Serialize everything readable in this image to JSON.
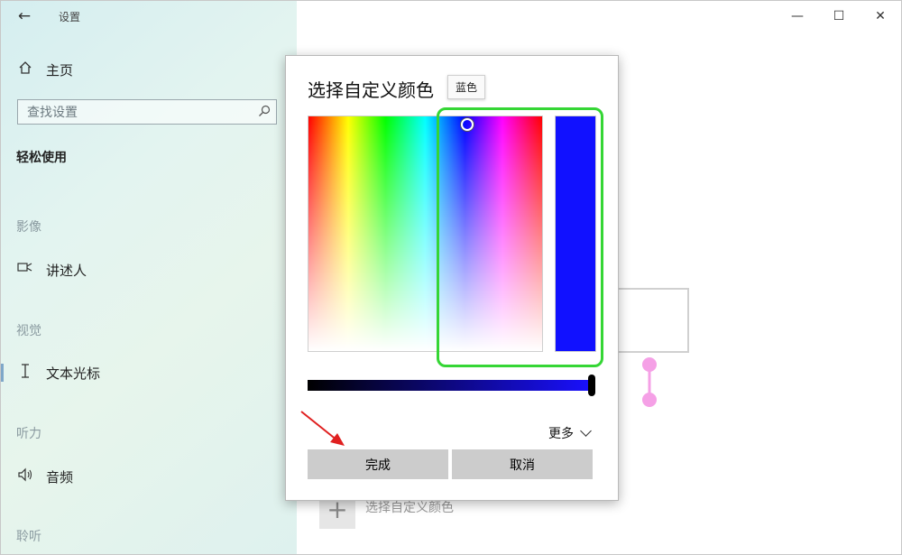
{
  "window": {
    "title": "设置",
    "controls": {
      "minimize": "—",
      "maximize": "☐",
      "close": "✕"
    }
  },
  "sidebar": {
    "home_label": "主页",
    "search": {
      "placeholder": "查找设置",
      "value": ""
    },
    "category": "轻松使用",
    "sections": [
      {
        "heading": "影像",
        "items": [
          {
            "label": "讲述人",
            "icon": "narrator-icon"
          }
        ]
      },
      {
        "heading": "视觉",
        "items": [
          {
            "label": "文本光标",
            "icon": "text-cursor-icon",
            "active": true
          }
        ]
      },
      {
        "heading": "听力",
        "items": [
          {
            "label": "音频",
            "icon": "speaker-icon"
          }
        ]
      },
      {
        "heading": "聆听",
        "items": []
      }
    ]
  },
  "main": {
    "add_color_label": "选择自定义颜色",
    "add_icon": "plus-icon"
  },
  "dialog": {
    "title": "选择自定义颜色",
    "tooltip": "蓝色",
    "selected_color": "#1111ff",
    "brightness_fraction": 1.0,
    "highlight_color": "#35d635",
    "annotation_arrow_color": "#e02020",
    "more_label": "更多",
    "done_label": "完成",
    "cancel_label": "取消"
  }
}
